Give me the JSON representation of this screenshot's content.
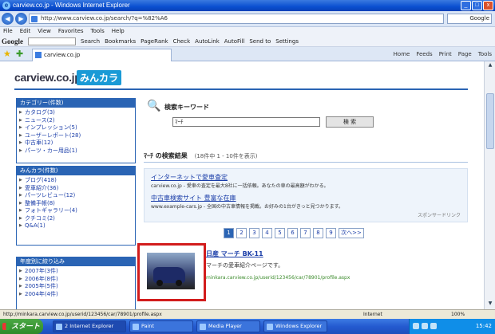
{
  "window": {
    "title": "carview.co.jp - Windows Internet Explorer",
    "buttons": [
      "_",
      "□",
      "x"
    ]
  },
  "address": {
    "url": "http://www.carview.co.jp/search/?q=%82%A6",
    "search": "Google"
  },
  "menu": [
    "File",
    "Edit",
    "View",
    "Favorites",
    "Tools",
    "Help"
  ],
  "google": {
    "logo": "Google",
    "items": [
      "Search",
      "Bookmarks",
      "PageRank",
      "Check",
      "AutoLink",
      "AutoFill",
      "Send to",
      "Settings"
    ]
  },
  "tab": {
    "label": "carview.co.jp"
  },
  "cmd": [
    "Home",
    "Feeds",
    "Print",
    "Page",
    "Tools"
  ],
  "site": {
    "brand": "carview.co.jp",
    "brand2": "みんカラ",
    "sidebar": [
      {
        "header": "カテゴリー(件数)",
        "items": [
          "カタログ(3)",
          "ニュース(2)",
          "インプレッション(5)",
          "ユーザーレポート(28)",
          "中古車(12)",
          "パーツ・カー用品(1)"
        ]
      },
      {
        "header": "みんカラ(件数)",
        "items": [
          "ブログ(418)",
          "愛車紹介(36)",
          "パーツレビュー(12)",
          "整備手帳(8)",
          "フォトギャラリー(4)",
          "クチコミ(2)",
          "Q&A(1)"
        ]
      },
      {
        "header": "年度別に絞り込み",
        "items": [
          "2007年(3件)",
          "2006年(8件)",
          "2005年(5件)",
          "2004年(4件)"
        ]
      }
    ],
    "search": {
      "label": "検索キーワード",
      "keyword": "ﾏｰﾁ",
      "button": "検 索"
    },
    "results": {
      "title": "ﾏｰﾁ の検索結果",
      "count": "(18件中 1 - 10件を表示)"
    },
    "ads": [
      {
        "title": "インターネットで愛車査定",
        "desc": "carview.co.jp - 愛車の査定を最大8社に一括依頼。あなたの車の最高額がわかる。"
      },
      {
        "title": "中古車検索サイト 豊富な在庫",
        "desc": "www.example-cars.jp - 全国の中古車情報を掲載。お好みの1台がきっと見つかります。"
      }
    ],
    "sponsor": "スポンサードリンク",
    "pager": {
      "pages": [
        "1",
        "2",
        "3",
        "4",
        "5",
        "6",
        "7",
        "8",
        "9"
      ],
      "current": "1",
      "next": "次へ>>"
    },
    "result": {
      "title": "日産 マーチ BK-11",
      "desc": "マーチの愛車紹介ページです。",
      "link": "minkara.carview.co.jp/userid/123456/car/78901/profile.aspx"
    }
  },
  "status": {
    "text": "http://minkara.carview.co.jp/userid/123456/car/78901/profile.aspx",
    "zone": "Internet",
    "zoom": "100%"
  },
  "taskbar": {
    "start": "スタート",
    "tasks": [
      "2 Internet Explorer",
      "Paint",
      "Media Player",
      "Windows Explorer"
    ],
    "clock": "15:42"
  }
}
